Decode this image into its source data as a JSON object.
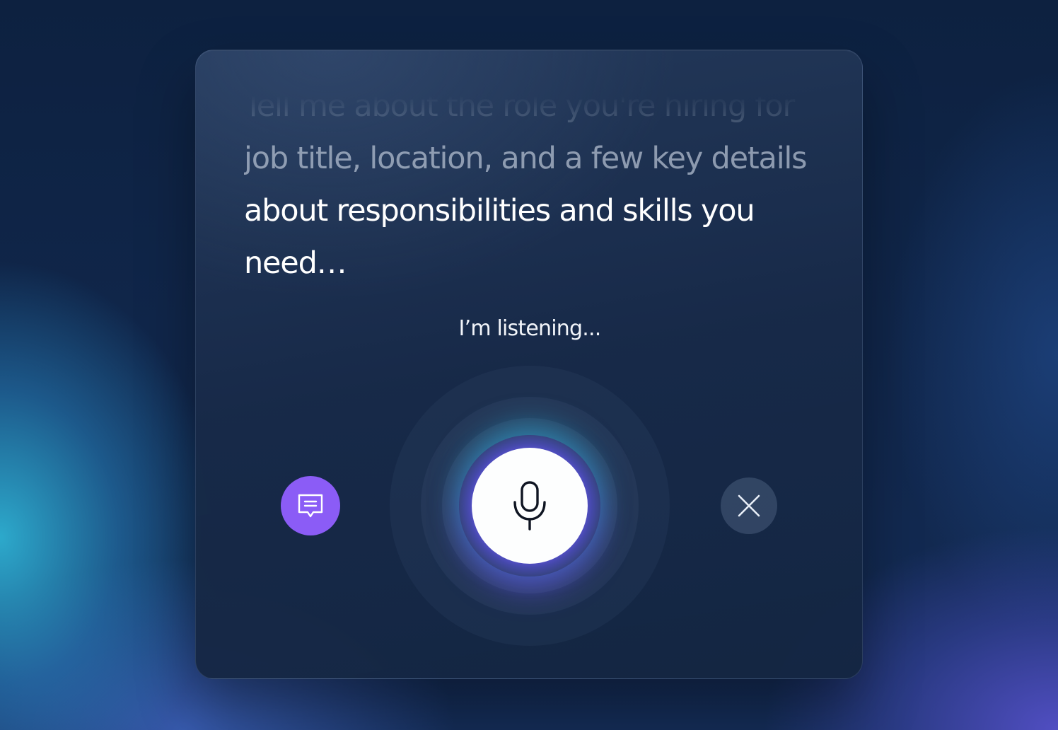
{
  "transcript": {
    "lines": [
      "Tell me about the role you're hiring for",
      "job title, location, and a few key details",
      "about responsibilities and skills you",
      "need…"
    ]
  },
  "status": {
    "label": "I’m listening..."
  },
  "controls": {
    "chat": {
      "icon": "chat-bubble-icon"
    },
    "mic": {
      "icon": "microphone-icon"
    },
    "close": {
      "icon": "close-icon"
    }
  },
  "colors": {
    "accent_purple": "#8b5cf6",
    "mic_button": "#fdfefe",
    "text_primary": "#ffffff"
  }
}
